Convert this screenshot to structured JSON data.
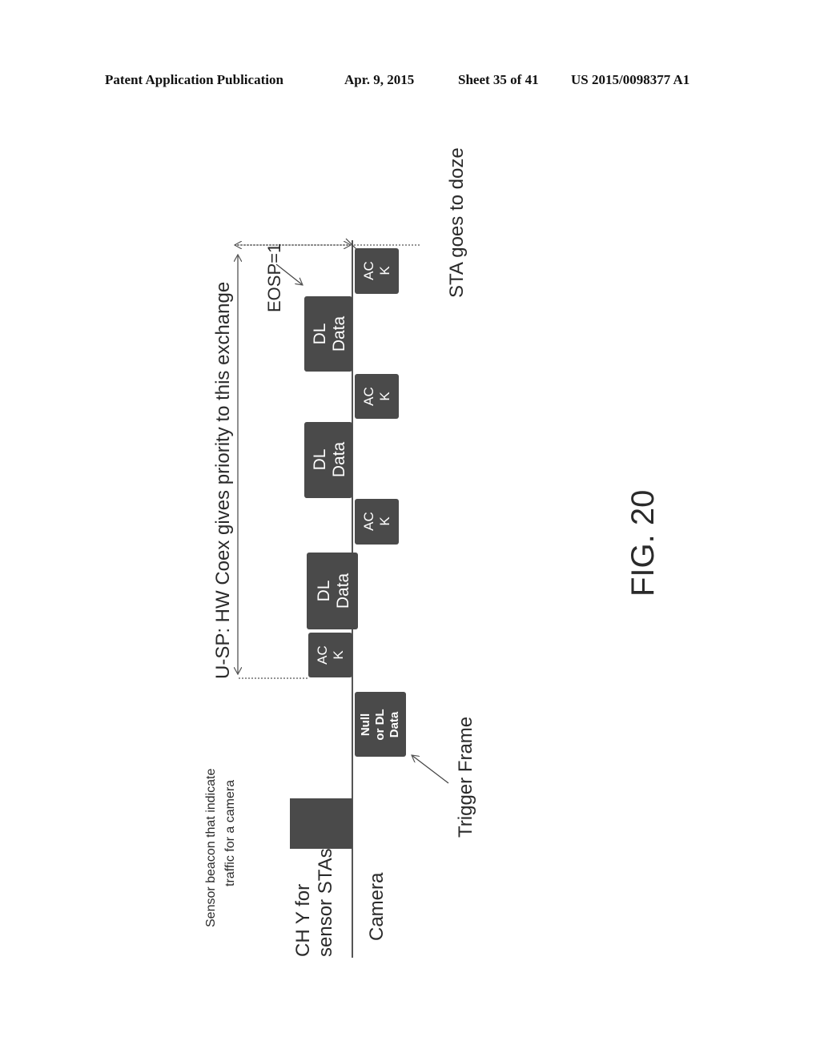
{
  "header": {
    "publication": "Patent Application Publication",
    "date": "Apr. 9, 2015",
    "sheet": "Sheet 35 of 41",
    "number": "US 2015/0098377 A1"
  },
  "diagram": {
    "figure_label": "FIG. 20",
    "lanes": {
      "channel_line1": "CH Y for",
      "channel_line2": "sensor STAs",
      "camera": "Camera"
    },
    "annotations": {
      "beacon_line1": "Sensor beacon that indicate",
      "beacon_line2": "traffic for a camera",
      "trigger": "Trigger Frame",
      "usp": "U-SP: HW Coex gives priority to this exchange",
      "eosp": "EOSP=1",
      "doze": "STA goes to doze"
    },
    "frames": [
      {
        "id": "beacon",
        "line1": "",
        "line2": "",
        "line3": ""
      },
      {
        "id": "null-or-dl-data",
        "line1": "Null",
        "line2": "or DL",
        "line3": "Data"
      },
      {
        "id": "ack-1",
        "line1": "AC",
        "line2": "K"
      },
      {
        "id": "dl-data-1",
        "line1": "DL",
        "line2": "Data"
      },
      {
        "id": "ack-2",
        "line1": "AC",
        "line2": "K"
      },
      {
        "id": "dl-data-2",
        "line1": "DL",
        "line2": "Data"
      },
      {
        "id": "ack-3",
        "line1": "AC",
        "line2": "K"
      },
      {
        "id": "dl-data-3",
        "line1": "DL",
        "line2": "Data"
      },
      {
        "id": "ack-4",
        "line1": "AC",
        "line2": "K"
      }
    ]
  }
}
